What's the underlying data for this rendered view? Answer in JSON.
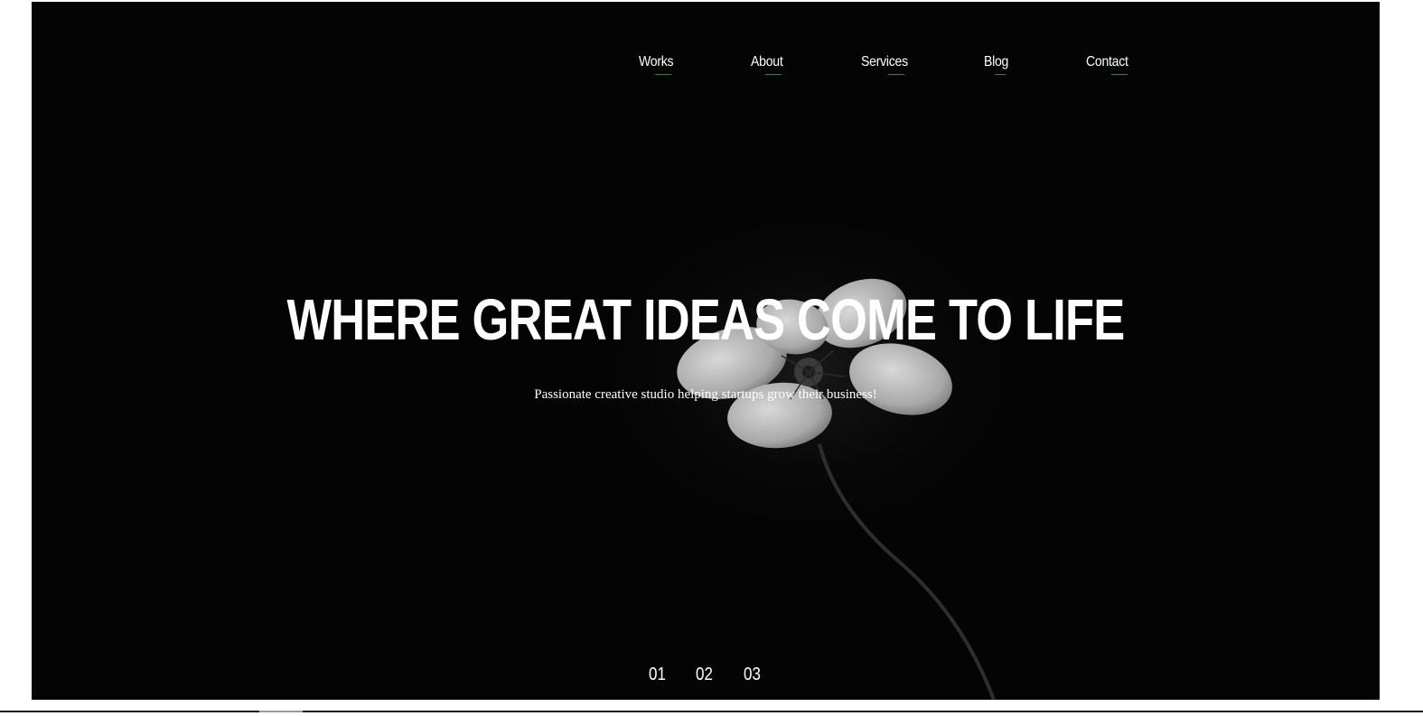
{
  "nav": {
    "items": [
      {
        "label": "Works"
      },
      {
        "label": "About"
      },
      {
        "label": "Services"
      },
      {
        "label": "Blog"
      },
      {
        "label": "Contact"
      }
    ]
  },
  "hero": {
    "headline": "WHERE GREAT IDEAS COME TO LIFE",
    "subtitle": "Passionate creative studio helping startups grow their business!"
  },
  "pager": {
    "items": [
      {
        "label": "01"
      },
      {
        "label": "02"
      },
      {
        "label": "03"
      }
    ]
  },
  "colors": {
    "background": "#040404",
    "text": "#ffffff",
    "accent_underline": "#1f8a2a"
  }
}
